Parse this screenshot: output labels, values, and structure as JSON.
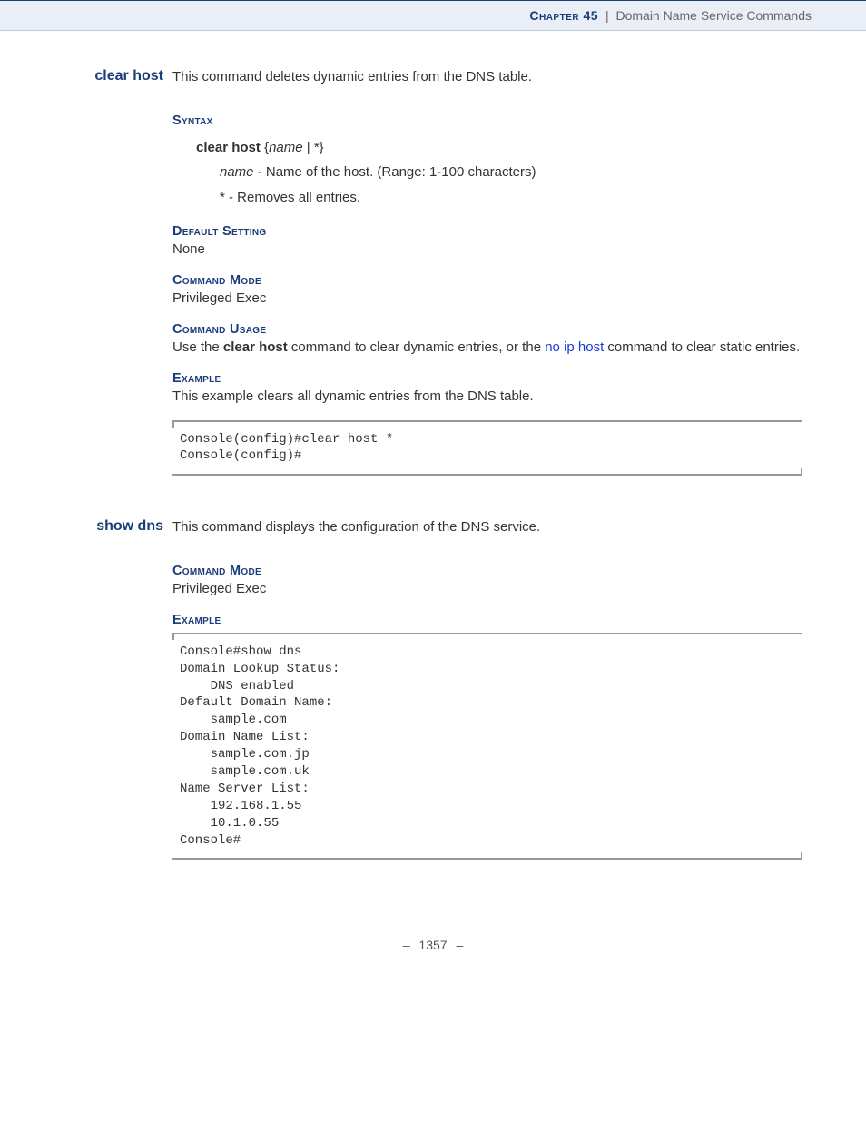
{
  "header": {
    "chapter_label": "Chapter 45",
    "separator": "|",
    "title": "Domain Name Service Commands"
  },
  "sections": {
    "clear_host": {
      "name": "clear host",
      "lead": "This command deletes dynamic entries from the DNS table.",
      "syntax_h": "Syntax",
      "syntax_cmd": "clear host",
      "syntax_args": "{name | *}",
      "param_name_label": "name",
      "param_name_desc": " - Name of the host. (Range: 1-100 characters)",
      "param_star_label": "*",
      "param_star_desc": " - Removes all entries.",
      "default_h": "Default Setting",
      "default_v": "None",
      "mode_h": "Command Mode",
      "mode_v": "Privileged Exec",
      "usage_h": "Command Usage",
      "usage_pre": "Use the ",
      "usage_cmd": "clear host",
      "usage_mid": " command to clear dynamic entries, or the ",
      "usage_link": "no ip host",
      "usage_post": " command to clear static entries.",
      "example_h": "Example",
      "example_lead": "This example clears all dynamic entries from the DNS table.",
      "example_code": "Console(config)#clear host *\nConsole(config)#"
    },
    "show_dns": {
      "name": "show dns",
      "lead": "This command displays the configuration of the DNS service.",
      "mode_h": "Command Mode",
      "mode_v": "Privileged Exec",
      "example_h": "Example",
      "example_code": "Console#show dns\nDomain Lookup Status:\n    DNS enabled\nDefault Domain Name:\n    sample.com\nDomain Name List:\n    sample.com.jp\n    sample.com.uk\nName Server List:\n    192.168.1.55\n    10.1.0.55\nConsole#"
    }
  },
  "footer": {
    "dash": "–",
    "page_no": "1357"
  }
}
